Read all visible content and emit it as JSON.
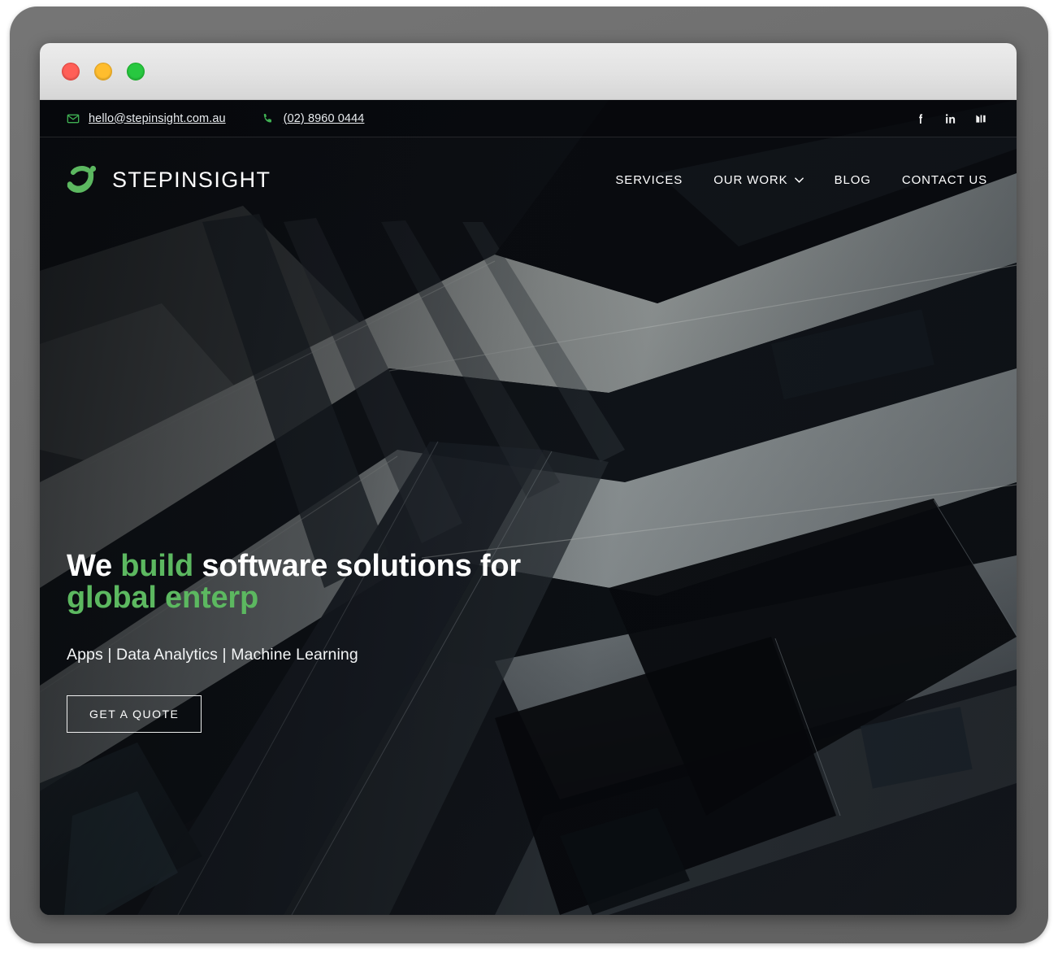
{
  "window": {
    "traffic_lights": [
      {
        "name": "close",
        "color": "#ff5f57"
      },
      {
        "name": "minimize",
        "color": "#ffbd2e"
      },
      {
        "name": "maximize",
        "color": "#28c840"
      }
    ]
  },
  "topbar": {
    "email": "hello@stepinsight.com.au",
    "phone": "(02) 8960 0444",
    "email_icon": "envelope-icon",
    "phone_icon": "phone-icon",
    "social": [
      {
        "name": "facebook",
        "icon": "facebook-icon"
      },
      {
        "name": "linkedin",
        "icon": "linkedin-icon"
      },
      {
        "name": "medium",
        "icon": "medium-icon"
      }
    ]
  },
  "brand": {
    "name": "STEPINSIGHT",
    "logo_icon": "stepinsight-logo-icon"
  },
  "nav": {
    "items": [
      {
        "label": "SERVICES",
        "has_dropdown": false
      },
      {
        "label": "OUR WORK",
        "has_dropdown": true
      },
      {
        "label": "BLOG",
        "has_dropdown": false
      },
      {
        "label": "CONTACT US",
        "has_dropdown": false
      }
    ]
  },
  "hero": {
    "title_part1": "We ",
    "title_accent1": "build",
    "title_part2": " software solutions for",
    "title_accent2": "global enterp",
    "subtitle": "Apps | Data Analytics | Machine Learning",
    "cta_label": "GET A QUOTE"
  },
  "colors": {
    "accent_green": "#5cb860",
    "icon_green": "#3faf52",
    "text_white": "#ffffff",
    "bezel_gray": "#6b6b6b",
    "titlebar_gray": "#e5e5e5"
  }
}
